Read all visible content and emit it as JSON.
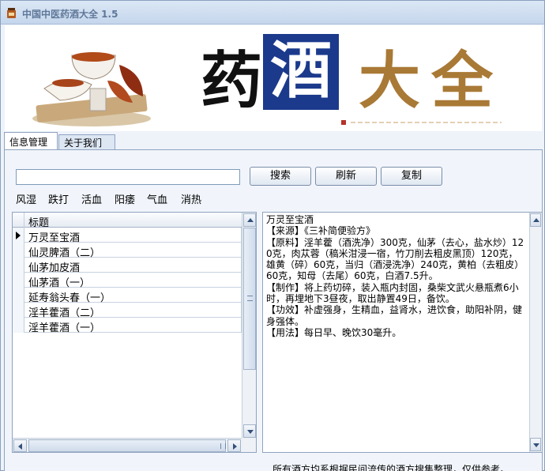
{
  "window": {
    "title": "中国中医药酒大全 1.5"
  },
  "banner": {
    "chars": [
      "药",
      "酒",
      "大",
      "全"
    ]
  },
  "tabs": [
    {
      "label": "信息管理",
      "active": true
    },
    {
      "label": "关于我们",
      "active": false
    }
  ],
  "search": {
    "value": "",
    "placeholder": ""
  },
  "buttons": {
    "search": "搜索",
    "refresh": "刷新",
    "copy": "复制"
  },
  "categories": [
    "风湿",
    "跌打",
    "活血",
    "阳痿",
    "气血",
    "消热"
  ],
  "grid": {
    "header": "标题",
    "rows": [
      "万灵至宝酒",
      "仙灵脾酒（二）",
      "仙茅加皮酒",
      "仙茅酒（一）",
      "延寿翁头春（一）",
      "淫羊藿酒（二）",
      "淫羊藿酒（一）"
    ],
    "selected_index": 0
  },
  "detail": {
    "text": "万灵至宝酒\n【来源】《三补简便验方》\n【原料】淫羊藿（酒洗净）300克，仙茅（去心，盐水炒）120克，肉苁蓉（稿米泔浸一宿，竹刀削去粗皮黑顶）120克，雄黄（碎）60克，当归（酒浸洗净）240克，黄柏（去粗皮）60克，知母（去尾）60克，白酒7.5升。\n【制作】将上药切碎，装入瓶内封固，桑柴文武火悬瓶煮6小时，再埋地下3昼夜，取出静置49日，备饮。\n【功效】补虚强身，生精血，益肾水，进饮食，助阳补阴，健身强体。\n【用法】每日早、晚饮30毫升。"
  },
  "footer": {
    "text": "所有酒方均系根据民间流传的酒方搜集整理，仅供参考。"
  },
  "colors": {
    "banner_blue": "#1b3a8c",
    "banner_gold": "#a97936",
    "title_text": "#5f7899"
  },
  "icons": {
    "app": "wine-jar-icon",
    "tea": "tea-cup-illustration"
  }
}
